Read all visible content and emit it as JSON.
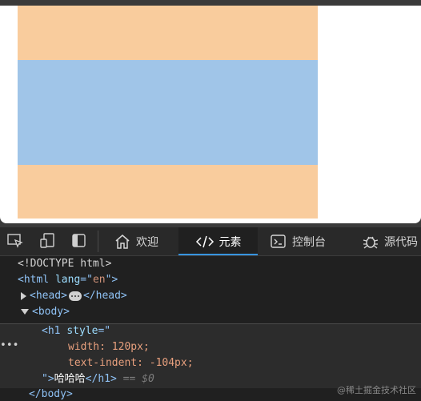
{
  "colors": {
    "block_orange": "#f9cc9d",
    "block_blue": "#a0c5e8",
    "tab_accent": "#3794e0"
  },
  "toolbar": {
    "icons": [
      "inspect-icon",
      "device-emulation-icon",
      "dock-panel-icon"
    ],
    "tabs": [
      {
        "label": "欢迎",
        "icon": "home-icon"
      },
      {
        "label": "元素",
        "icon": "code-brackets-icon"
      },
      {
        "label": "控制台",
        "icon": "console-icon"
      },
      {
        "label": "源代码",
        "icon": "bug-icon"
      }
    ]
  },
  "dom": {
    "doctype": "<!DOCTYPE html>",
    "html_open": "<html ",
    "html_attr": "lang",
    "html_eq": "=\"",
    "html_val": "en",
    "html_close": "\">",
    "head_open": "<head>",
    "head_close": "</head>",
    "body_open": "<body>",
    "h1_open": "<h1 ",
    "h1_attr": "style",
    "h1_eq": "=\"",
    "css_prop_1": "width",
    "css_val_1": ": 120px;",
    "css_prop_2": "text-indent",
    "css_val_2": ": -104px;",
    "h1_text_prefix": "\">",
    "h1_text": "哈哈哈",
    "h1_close": "</h1>",
    "selected_hint": "== $0",
    "body_close": "</body>",
    "ellipsis": "•••"
  },
  "watermark": "@稀土掘金技术社区"
}
